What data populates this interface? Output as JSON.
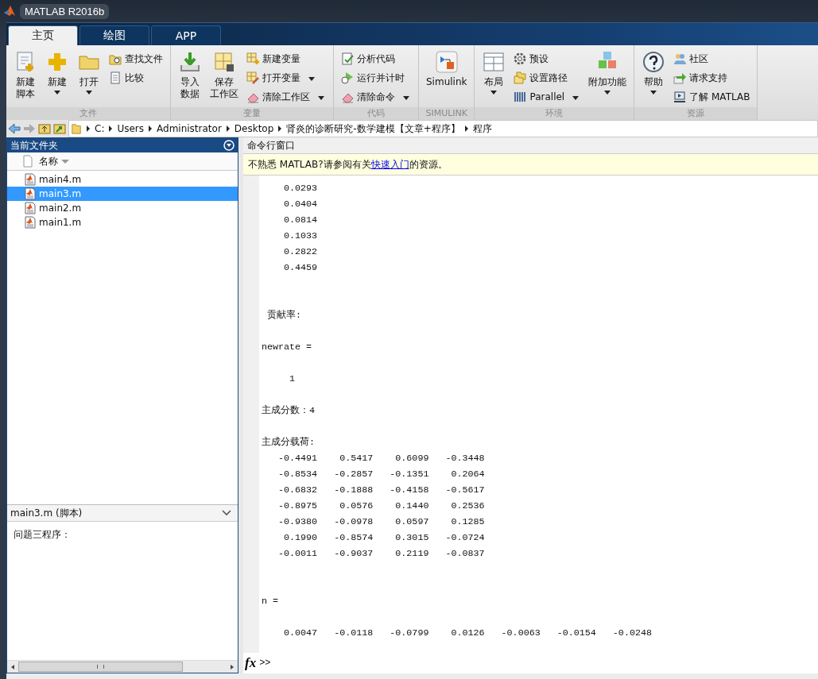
{
  "window": {
    "title": "MATLAB R2016b"
  },
  "tabs": [
    {
      "label": "主页",
      "selected": true
    },
    {
      "label": "绘图",
      "selected": false
    },
    {
      "label": "APP",
      "selected": false
    }
  ],
  "ribbon": [
    {
      "label": "文件",
      "items": [
        {
          "kind": "large",
          "label": [
            "新建",
            "脚本"
          ],
          "dropdown": false
        },
        {
          "kind": "large",
          "label": [
            "新建"
          ],
          "dropdown": true
        },
        {
          "kind": "large",
          "label": [
            "打开"
          ],
          "dropdown": true
        },
        {
          "kind": "column",
          "items": [
            {
              "label": "查找文件",
              "dropdown": false
            },
            {
              "label": "比较",
              "dropdown": false
            }
          ]
        }
      ]
    },
    {
      "label": "变量",
      "items": [
        {
          "kind": "large",
          "label": [
            "导入",
            "数据"
          ],
          "dropdown": false
        },
        {
          "kind": "large",
          "label": [
            "保存",
            "工作区"
          ],
          "dropdown": false
        },
        {
          "kind": "column",
          "items": [
            {
              "label": "新建变量",
              "dropdown": false
            },
            {
              "label": "打开变量",
              "dropdown": true
            },
            {
              "label": "清除工作区",
              "dropdown": true
            }
          ]
        }
      ]
    },
    {
      "label": "代码",
      "items": [
        {
          "kind": "column",
          "items": [
            {
              "label": "分析代码",
              "dropdown": false
            },
            {
              "label": "运行并计时",
              "dropdown": false
            },
            {
              "label": "清除命令",
              "dropdown": true
            }
          ]
        }
      ]
    },
    {
      "label": "SIMULINK",
      "items": [
        {
          "kind": "large",
          "label": [
            "Simulink"
          ],
          "dropdown": false
        }
      ]
    },
    {
      "label": "环境",
      "items": [
        {
          "kind": "large",
          "label": [
            "布局"
          ],
          "dropdown": true
        },
        {
          "kind": "column",
          "items": [
            {
              "label": "预设",
              "dropdown": false
            },
            {
              "label": "设置路径",
              "dropdown": false
            },
            {
              "label": "Parallel",
              "dropdown": true
            }
          ]
        },
        {
          "kind": "large",
          "label": [
            "附加功能"
          ],
          "dropdown": true
        }
      ]
    },
    {
      "label": "资源",
      "items": [
        {
          "kind": "large",
          "label": [
            "帮助"
          ],
          "dropdown": true
        },
        {
          "kind": "column",
          "items": [
            {
              "label": "社区",
              "dropdown": false
            },
            {
              "label": "请求支持",
              "dropdown": false
            },
            {
              "label": "了解 MATLAB",
              "dropdown": false
            }
          ]
        }
      ]
    }
  ],
  "address": [
    "C:",
    "Users",
    "Administrator",
    "Desktop",
    "肾炎的诊断研究-数学建模【文章+程序】",
    "程序"
  ],
  "current_folder": {
    "title": "当前文件夹",
    "column": "名称",
    "files": [
      {
        "name": "main4.m",
        "selected": false
      },
      {
        "name": "main3.m",
        "selected": true
      },
      {
        "name": "main2.m",
        "selected": false
      },
      {
        "name": "main1.m",
        "selected": false
      }
    ]
  },
  "details": {
    "title": "main3.m  (脚本)",
    "text": "问题三程序："
  },
  "command_window": {
    "title": "命令行窗口",
    "notice": {
      "before": "不熟悉 MATLAB?请参阅有关",
      "link": "快速入门",
      "after": "的资源。"
    },
    "lines": [
      {
        "kind": "text",
        "text": "    0.0293"
      },
      {
        "kind": "text",
        "text": "    0.0404"
      },
      {
        "kind": "text",
        "text": "    0.0814"
      },
      {
        "kind": "text",
        "text": "    0.1033"
      },
      {
        "kind": "text",
        "text": "    0.2822"
      },
      {
        "kind": "text",
        "text": "    0.4459"
      },
      {
        "kind": "blank"
      },
      {
        "kind": "blank"
      },
      {
        "kind": "text",
        "text": " 贡献率:"
      },
      {
        "kind": "blank"
      },
      {
        "kind": "text",
        "text": "newrate ="
      },
      {
        "kind": "blank"
      },
      {
        "kind": "text",
        "text": "     1"
      },
      {
        "kind": "blank"
      },
      {
        "kind": "text",
        "text": "主成分数：4"
      },
      {
        "kind": "blank"
      },
      {
        "kind": "text",
        "text": "主成分载荷:"
      },
      {
        "kind": "text",
        "text": "   -0.4491    0.5417    0.6099   -0.3448"
      },
      {
        "kind": "text",
        "text": "   -0.8534   -0.2857   -0.1351    0.2064"
      },
      {
        "kind": "text",
        "text": "   -0.6832   -0.1888   -0.4158   -0.5617"
      },
      {
        "kind": "text",
        "text": "   -0.8975    0.0576    0.1440    0.2536"
      },
      {
        "kind": "text",
        "text": "   -0.9380   -0.0978    0.0597    0.1285"
      },
      {
        "kind": "text",
        "text": "    0.1990   -0.8574    0.3015   -0.0724"
      },
      {
        "kind": "text",
        "text": "   -0.0011   -0.9037    0.2119   -0.0837"
      },
      {
        "kind": "blank"
      },
      {
        "kind": "blank"
      },
      {
        "kind": "text",
        "text": "n ="
      },
      {
        "kind": "blank"
      },
      {
        "kind": "text",
        "text": "    0.0047   -0.0118   -0.0799    0.0126   -0.0063   -0.0154   -0.0248"
      }
    ],
    "function_button": "fx",
    "prompt": ">>"
  }
}
